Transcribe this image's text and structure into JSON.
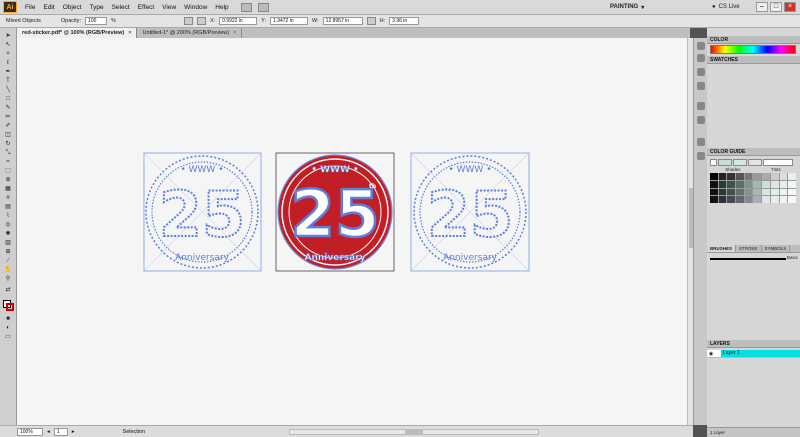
{
  "menus": [
    "File",
    "Edit",
    "Object",
    "Type",
    "Select",
    "Effect",
    "View",
    "Window",
    "Help"
  ],
  "workspace": "PAINTING",
  "cs_live": "CS Live",
  "control": {
    "selection_label": "Mixed Objects",
    "opacity_label": "Opacity:",
    "opacity_value": "100",
    "opacity_unit": "%",
    "x_label": "X:",
    "x_value": "0.9922 in",
    "y_label": "Y:",
    "y_value": "1.9472 in",
    "w_label": "W:",
    "w_value": "12.8957 in",
    "h_label": "H:",
    "h_value": "3.96 in"
  },
  "tabs": [
    {
      "label": "red-sticker.pdf* @ 100% (RGB/Preview)"
    },
    {
      "label": "Untitled-1* @ 200% (RGB/Preview)"
    }
  ],
  "artwork": {
    "number": "25",
    "top_text": "• WWW •",
    "bottom_text": "Anniversary",
    "suffix": "th",
    "red": "#c21e26",
    "outline_blue": "#5a7fe0"
  },
  "status": {
    "zoom": "100%",
    "artboard": "1",
    "tool": "Selection"
  },
  "panels": {
    "color": "COLOR",
    "swatches": "SWATCHES",
    "color_guide": "COLOR GUIDE",
    "shades": "Shades",
    "tints": "Tints",
    "brushes": "BRUSHES",
    "stroke": "STROKE",
    "symbols": "SYMBOLS",
    "brush_name": "Basic",
    "layers": "LAYERS",
    "layer_name": "Layer 1",
    "layer_count": "1 Layer"
  }
}
